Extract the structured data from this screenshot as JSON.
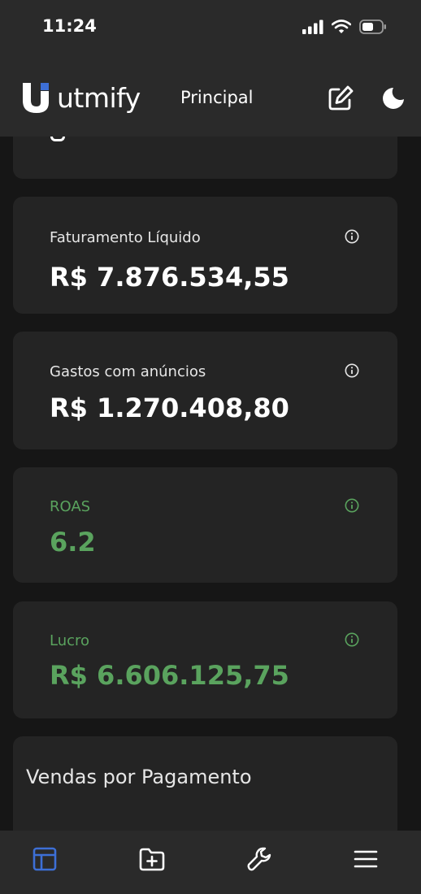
{
  "status_bar": {
    "time": "11:24"
  },
  "header": {
    "logo_text": "utmify",
    "title": "Principal"
  },
  "cards": [
    {
      "label": "Faturamento Líquido",
      "value": "R$ 7.876.534,55"
    },
    {
      "label": "Gastos com anúncios",
      "value": "R$ 1.270.408,80"
    },
    {
      "label": "ROAS",
      "value": "6.2"
    },
    {
      "label": "Lucro",
      "value": "R$ 6.606.125,75"
    }
  ],
  "section": {
    "title": "Vendas por Pagamento"
  },
  "colors": {
    "accent_green": "#5aa35e",
    "active_nav_blue": "#3d6fd6",
    "card_bg": "#242424",
    "page_bg": "#161616",
    "bar_bg": "#2a2a2a"
  },
  "icons": {
    "edit": "edit-icon",
    "theme": "moon-icon",
    "info": "info-icon",
    "nav": [
      "dashboard-icon",
      "folder-plus-icon",
      "wrench-icon",
      "menu-icon"
    ]
  }
}
